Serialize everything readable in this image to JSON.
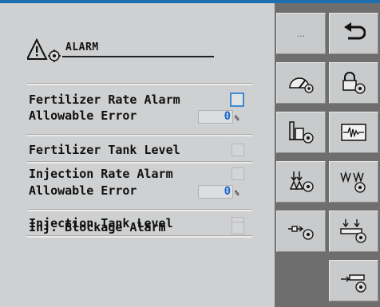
{
  "alarm": {
    "title": "ALARM",
    "rows": [
      {
        "label": "Fertilizer Rate Alarm"
      },
      {
        "label": "Allowable Error",
        "value": "0",
        "unit": "%"
      },
      {
        "label": "Fertilizer Tank Level"
      },
      {
        "label": "Injection Rate Alarm"
      },
      {
        "label": "Allowable Error",
        "value": "0",
        "unit": "%"
      },
      {
        "label": "Injection Tank Level"
      },
      {
        "label": "Inj. Blockage Alarm"
      }
    ]
  },
  "softkeys": {
    "more_label": "...",
    "icons": [
      "more-icon",
      "back-icon",
      "gauge-settings-icon",
      "security-settings-icon",
      "tank-level-settings-icon",
      "waveform-icon",
      "flow-settings-icon",
      "pattern-settings-icon",
      "injection-settings-icon",
      "blockage-settings-icon",
      "section-settings-icon"
    ]
  },
  "colors": {
    "accent": "#1d6fb0",
    "value_text": "#1b67d0",
    "panel": "#cfd0d1",
    "softkey_bg": "#6e6e6e"
  }
}
